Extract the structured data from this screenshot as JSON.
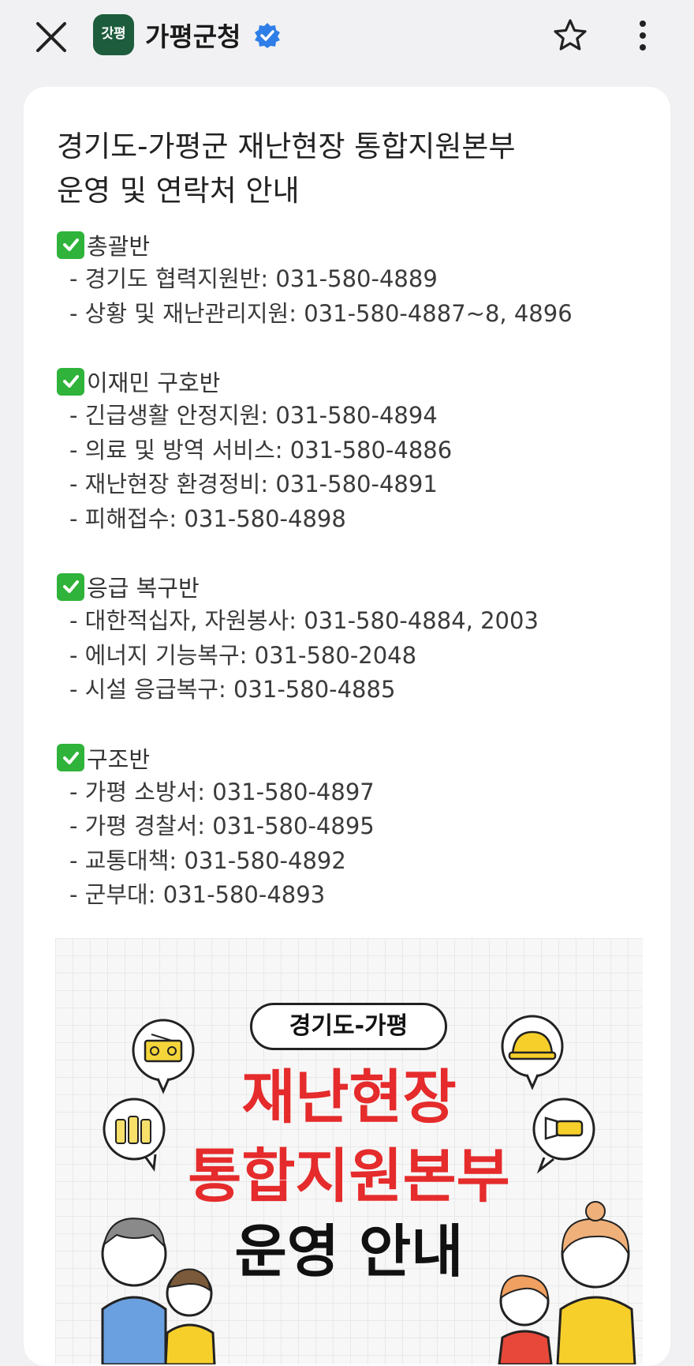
{
  "header": {
    "channel_logo_text": "갓평",
    "channel_name": "가평군청"
  },
  "post": {
    "title_line1": "경기도-가평군 재난현장 통합지원본부",
    "title_line2": "운영 및 연락처 안내",
    "sections": [
      {
        "heading": "총괄반",
        "items": [
          "- 경기도 협력지원반: 031-580-4889",
          "- 상황 및 재난관리지원: 031-580-4887~8, 4896"
        ]
      },
      {
        "heading": "이재민 구호반",
        "items": [
          "- 긴급생활 안정지원: 031-580-4894",
          "- 의료 및 방역 서비스: 031-580-4886",
          "- 재난현장 환경정비: 031-580-4891",
          "- 피해접수: 031-580-4898"
        ]
      },
      {
        "heading": "응급 복구반",
        "items": [
          "- 대한적십자, 자원봉사: 031-580-4884, 2003",
          "- 에너지 기능복구: 031-580-2048",
          "- 시설 응급복구: 031-580-4885"
        ]
      },
      {
        "heading": "구조반",
        "items": [
          "- 가평 소방서: 031-580-4897",
          "- 가평 경찰서: 031-580-4895",
          "- 교통대책: 031-580-4892",
          "- 군부대: 031-580-4893"
        ]
      }
    ]
  },
  "banner": {
    "pill": "경기도-가평",
    "line1": "재난현장",
    "line2": "통합지원본부",
    "line3": "운영 안내"
  },
  "colors": {
    "logo_bg": "#1d5c3c",
    "verified": "#2f7ee8",
    "check": "#2fb33a",
    "banner_red": "#e52b2b"
  },
  "icons": [
    "close-icon",
    "verified-badge-icon",
    "star-icon",
    "more-vertical-icon",
    "check-icon",
    "radio-icon",
    "hardhat-icon",
    "water-bottles-icon",
    "flashlight-icon"
  ]
}
